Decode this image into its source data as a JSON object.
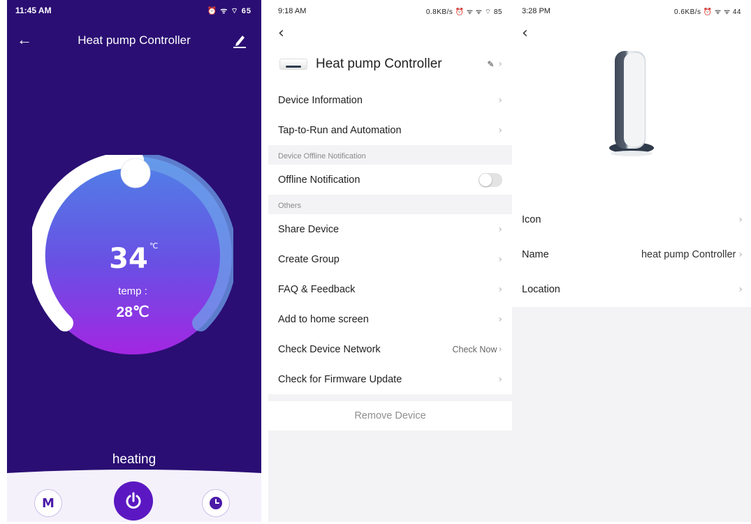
{
  "panel1": {
    "status_time": "11:45 AM",
    "status_icons": "⏰ ᯤ ⌔ 65",
    "back_icon": "arrow-left-icon",
    "title": "Heat pump Controller",
    "edit_icon": "pencil-icon",
    "set_temp": "34",
    "unit": "℃",
    "temp_label": "temp :",
    "current_temp": "28℃",
    "set_temp_fraction": 0.5,
    "state": "heating",
    "mode_button": "M",
    "power_icon": "power-icon",
    "timer_icon": "clock-icon",
    "colors": {
      "background": "#2a0e73",
      "dial_top": "#4f82e6",
      "dial_bottom": "#a326e2",
      "accent": "#5b18c2"
    }
  },
  "panel2": {
    "status_time": "9:18 AM",
    "status_icons": "0.8KB/s ⏰ ᯤ ᯤ ⌔ 85",
    "device_name": "Heat pump Controller",
    "rows_top": [
      {
        "label": "Device Information"
      },
      {
        "label": "Tap-to-Run and Automation"
      }
    ],
    "section_offline": "Device Offline Notification",
    "offline_label": "Offline Notification",
    "offline_enabled": false,
    "section_others": "Others",
    "rows_others": [
      {
        "label": "Share Device"
      },
      {
        "label": "Create Group"
      },
      {
        "label": "FAQ & Feedback"
      },
      {
        "label": "Add to home screen"
      },
      {
        "label": "Check Device Network",
        "extra": "Check Now"
      },
      {
        "label": "Check for Firmware Update"
      }
    ],
    "remove_label": "Remove Device"
  },
  "panel3": {
    "status_time": "3:28 PM",
    "status_icons": "0.6KB/s ⏰ ᯤ ᯤ 44",
    "rows": [
      {
        "label": "Icon",
        "value": ""
      },
      {
        "label": "Name",
        "value": "heat pump Controller"
      },
      {
        "label": "Location",
        "value": ""
      }
    ]
  }
}
